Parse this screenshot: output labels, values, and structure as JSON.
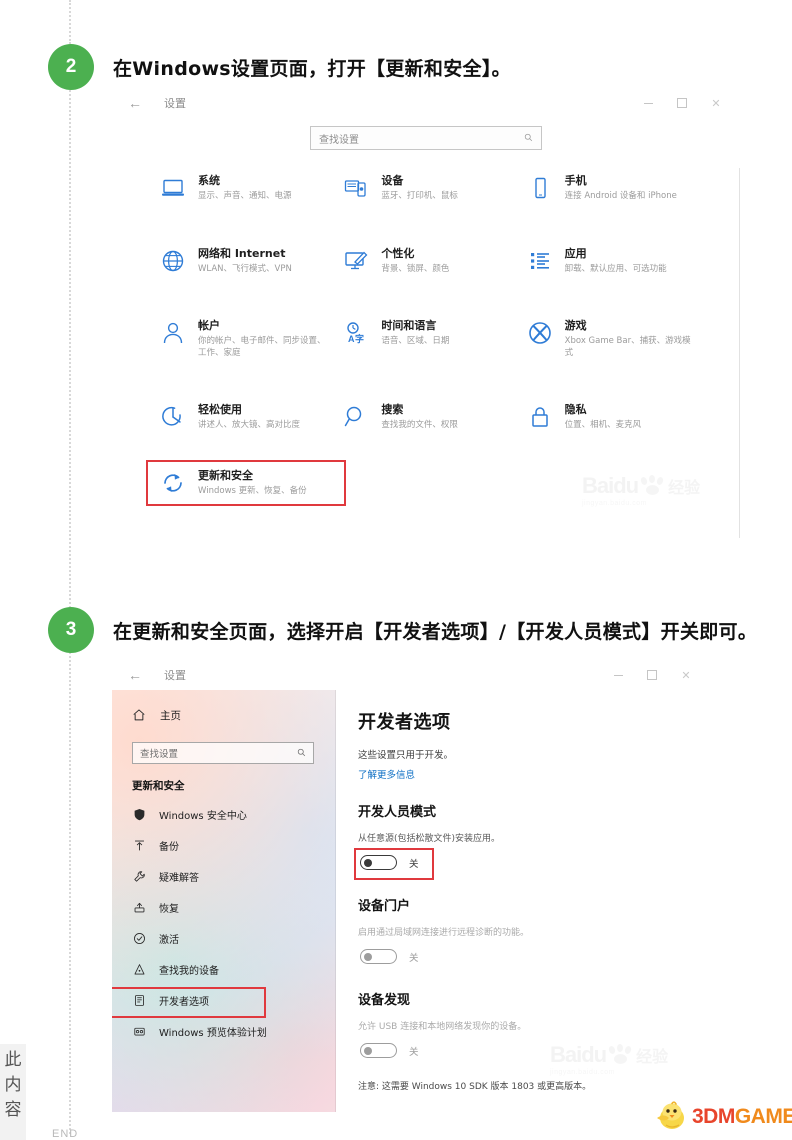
{
  "tutorial": {
    "steps": [
      {
        "number": "2",
        "title": "在Windows设置页面，打开【更新和安全】。"
      },
      {
        "number": "3",
        "title": "在更新和安全页面，选择开启【开发者选项】/【开发人员模式】开关即可。"
      }
    ],
    "end_label": "END",
    "edge_chars": [
      "此",
      "内",
      "容"
    ]
  },
  "brand": {
    "part1": "3DM",
    "part2": "GAME"
  },
  "watermark": {
    "word": "Baidu",
    "cn": "经验",
    "url": "jingyan.baidu.com"
  },
  "window_home": {
    "title": "设置",
    "back_icon": "back-arrow-icon",
    "controls": {
      "minimize": "–",
      "maximize": "□",
      "close": "✕"
    },
    "search": {
      "placeholder": "查找设置",
      "icon": "search-icon"
    },
    "tiles": [
      {
        "icon": "system-monitor-icon",
        "name": "系统",
        "desc": "显示、声音、通知、电源"
      },
      {
        "icon": "devices-icon",
        "name": "设备",
        "desc": "蓝牙、打印机、鼠标"
      },
      {
        "icon": "phone-icon",
        "name": "手机",
        "desc": "连接 Android 设备和 iPhone"
      },
      {
        "icon": "globe-icon",
        "name": "网络和 Internet",
        "desc": "WLAN、飞行模式、VPN"
      },
      {
        "icon": "personalization-icon",
        "name": "个性化",
        "desc": "背景、锁屏、颜色"
      },
      {
        "icon": "apps-list-icon",
        "name": "应用",
        "desc": "卸载、默认应用、可选功能"
      },
      {
        "icon": "account-person-icon",
        "name": "帐户",
        "desc": "你的帐户、电子邮件、同步设置、工作、家庭"
      },
      {
        "icon": "clock-language-icon",
        "name": "时间和语言",
        "desc": "语音、区域、日期"
      },
      {
        "icon": "xbox-icon",
        "name": "游戏",
        "desc": "Xbox Game Bar、捕获、游戏模式"
      },
      {
        "icon": "ease-of-access-icon",
        "name": "轻松使用",
        "desc": "讲述人、放大镜、高对比度"
      },
      {
        "icon": "search-magnifier-icon",
        "name": "搜索",
        "desc": "查找我的文件、权限"
      },
      {
        "icon": "lock-icon",
        "name": "隐私",
        "desc": "位置、相机、麦克风"
      }
    ],
    "highlighted_tile": {
      "icon": "update-refresh-icon",
      "name": "更新和安全",
      "desc": "Windows 更新、恢复、备份",
      "highlight_color": "#e0393e"
    }
  },
  "window_dev": {
    "title": "设置",
    "back_icon": "back-arrow-icon",
    "controls": {
      "minimize": "–",
      "maximize": "□",
      "close": "✕"
    },
    "sidebar": {
      "home": {
        "icon": "home-icon",
        "label": "主页"
      },
      "search": {
        "placeholder": "查找设置",
        "icon": "search-icon"
      },
      "section": "更新和安全",
      "items": [
        {
          "icon": "shield-icon",
          "label": "Windows 安全中心",
          "selected": false
        },
        {
          "icon": "backup-icon",
          "label": "备份",
          "selected": false
        },
        {
          "icon": "wrench-icon",
          "label": "疑难解答",
          "selected": false
        },
        {
          "icon": "recovery-icon",
          "label": "恢复",
          "selected": false
        },
        {
          "icon": "check-circle-icon",
          "label": "激活",
          "selected": false
        },
        {
          "icon": "find-device-icon",
          "label": "查找我的设备",
          "selected": false
        },
        {
          "icon": "developer-icon",
          "label": "开发者选项",
          "selected": true
        },
        {
          "icon": "insider-icon",
          "label": "Windows 预览体验计划",
          "selected": false
        }
      ]
    },
    "main": {
      "heading": "开发者选项",
      "subtext": "这些设置只用于开发。",
      "link": "了解更多信息",
      "sections": [
        {
          "heading": "开发人员模式",
          "desc": "从任意源(包括松散文件)安装应用。",
          "toggle_state": "关",
          "toggle_on": false,
          "highlighted": true
        },
        {
          "heading": "设备门户",
          "desc": "启用通过局域网连接进行远程诊断的功能。",
          "toggle_state": "关",
          "toggle_on": false,
          "highlighted": false
        },
        {
          "heading": "设备发现",
          "desc": "允许 USB 连接和本地网络发现你的设备。",
          "toggle_state": "关",
          "toggle_on": false,
          "highlighted": false
        }
      ],
      "note": "注意: 这需要 Windows 10 SDK 版本 1803 或更高版本。"
    }
  }
}
